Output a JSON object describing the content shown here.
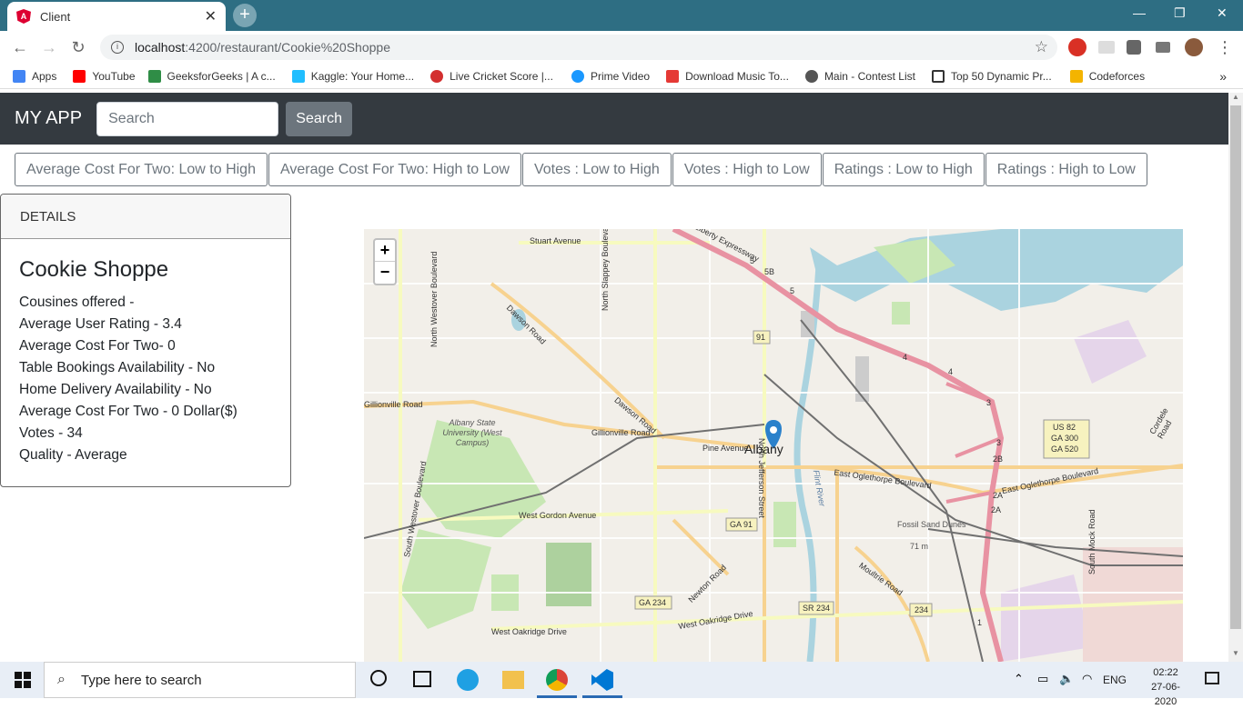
{
  "browser": {
    "tab_title": "Client",
    "url_host": "localhost",
    "url_rest": ":4200/restaurant/Cookie%20Shoppe",
    "bookmarks": [
      {
        "label": "Apps",
        "color": "#4285f4"
      },
      {
        "label": "YouTube",
        "color": "#ff0000"
      },
      {
        "label": "GeeksforGeeks | A c...",
        "color": "#2f8d46"
      },
      {
        "label": "Kaggle: Your Home...",
        "color": "#20beff"
      },
      {
        "label": "Live Cricket Score |...",
        "color": "#d32f2f"
      },
      {
        "label": "Prime Video",
        "color": "#1a98ff"
      },
      {
        "label": "Download Music To...",
        "color": "#e53935"
      },
      {
        "label": "Main - Contest List",
        "color": "#555555"
      },
      {
        "label": "Top 50 Dynamic Pr...",
        "color": "#333333"
      },
      {
        "label": "Codeforces",
        "color": "#f4b400"
      }
    ]
  },
  "navbar": {
    "brand": "MY APP",
    "search_placeholder": "Search",
    "search_button": "Search"
  },
  "sort_buttons": [
    "Average Cost For Two: Low to High",
    "Average Cost For Two: High to Low",
    "Votes : Low to High",
    "Votes : High to Low",
    "Ratings : Low to High",
    "Ratings : High to Low"
  ],
  "details": {
    "header": "DETAILS",
    "name": "Cookie Shoppe",
    "lines": [
      "Cousines offered -",
      "Average User Rating - 3.4",
      "Average Cost For Two- 0",
      "Table Bookings Availability - No",
      "Home Delivery Availability - No",
      "Average Cost For Two - 0 Dollar($)",
      "Votes - 34",
      "Quality - Average"
    ]
  },
  "map": {
    "zoom_in": "+",
    "zoom_out": "−",
    "city": "Albany",
    "labels": {
      "stuart": "Stuart Avenue",
      "dawson": "Dawson Road",
      "slappey": "North Slappey Boulevard",
      "westover": "North Westover Boulevard",
      "jefferson": "North Jefferson Street",
      "gillionville": "Gillionville Road",
      "pine": "Pine Avenue",
      "oglethorpe": "East Oglethorpe Boulevard",
      "gordon": "West Gordon Avenue",
      "oakridge": "West Oakridge Drive",
      "woakridge2": "West Oakridge Drive",
      "newton": "Newton Road",
      "moultrie": "Moultrie Road",
      "swestover": "South Westover Boulevard",
      "flint": "Flint River",
      "university": "Albany State University (West Campus)",
      "dunes": "Fossil Sand Dunes",
      "dunes_elev": "71 m",
      "us82": "US 82",
      "ga300": "GA 300",
      "ga520": "GA 520",
      "ga91": "GA 91",
      "r91": "91",
      "ga234": "GA 234",
      "sr234": "SR 234",
      "r234": "234",
      "cordele": "Cordele Road",
      "mock": "South Mock Road",
      "expressway": "Liberty Expressway",
      "e4": "4",
      "e4b": "4",
      "e3": "3",
      "e3b": "3",
      "e2b": "2B",
      "e2a": "2A",
      "e2a2": "2A",
      "e5": "5",
      "e5b": "5B",
      "e5c": "5",
      "e1": "1",
      "eoglethorpe2": "East Oglethorpe Boulevard",
      "cwvl": "Gillionville Road"
    }
  },
  "taskbar": {
    "search_placeholder": "Type here to search",
    "lang": "ENG",
    "time": "02:22",
    "date": "27-06-2020"
  }
}
